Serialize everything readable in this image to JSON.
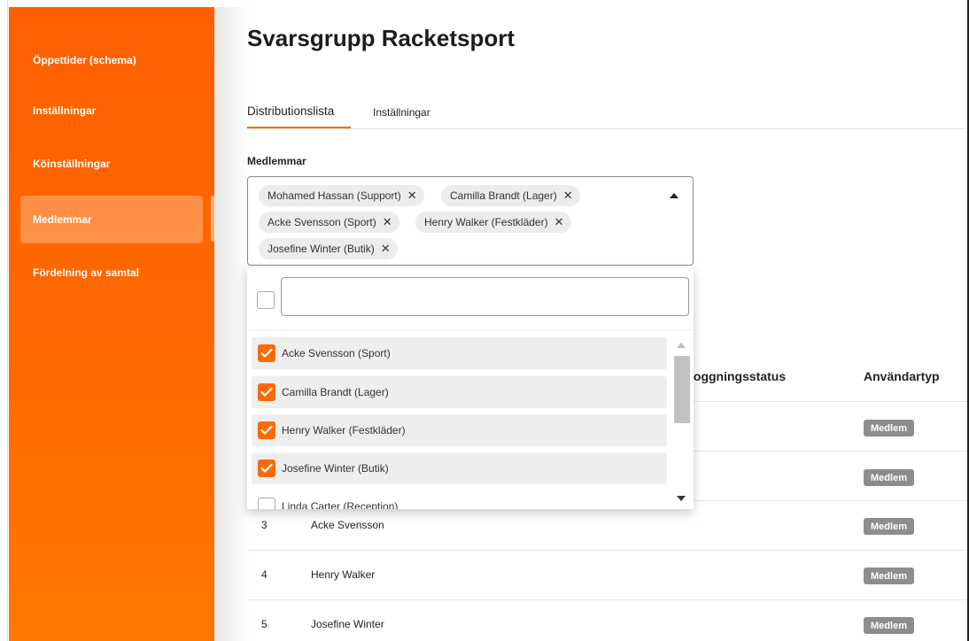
{
  "colors": {
    "accent": "#ff6a00",
    "sidebar": "#ff6200",
    "badge": "#8d8d8d"
  },
  "sidebar": {
    "items": [
      {
        "label": "Öppettider (schema)",
        "active": false
      },
      {
        "label": "Inställningar",
        "active": false
      },
      {
        "label": "Köinställningar",
        "active": false
      },
      {
        "label": "Medlemmar",
        "active": true
      },
      {
        "label": "Fördelning av samtal",
        "active": false
      }
    ]
  },
  "page": {
    "title": "Svarsgrupp Racketsport"
  },
  "tabs": [
    {
      "label": "Distributionslista",
      "active": true
    },
    {
      "label": "Inställningar",
      "active": false
    }
  ],
  "members_field": {
    "label": "Medlemmar",
    "chips": [
      "Mohamed Hassan (Support)",
      "Camilla Brandt (Lager)",
      "Acke Svensson (Sport)",
      "Henry Walker (Festkläder)",
      "Josefine Winter (Butik)"
    ],
    "chip_remove_glyph": "✕",
    "search_value": "",
    "options": [
      {
        "label": "Acke Svensson (Sport)",
        "checked": true
      },
      {
        "label": "Camilla Brandt (Lager)",
        "checked": true
      },
      {
        "label": "Henry Walker (Festkläder)",
        "checked": true
      },
      {
        "label": "Josefine Winter (Butik)",
        "checked": true
      },
      {
        "label": "Linda Carter (Reception)",
        "checked": false
      }
    ]
  },
  "table": {
    "headers": {
      "login_status": "loggningsstatus",
      "user_type": "Användartyp"
    },
    "rows": [
      {
        "num": "",
        "name": "",
        "type": "Medlem"
      },
      {
        "num": "",
        "name": "",
        "type": "Medlem"
      },
      {
        "num": "3",
        "name": "Acke Svensson",
        "type": "Medlem"
      },
      {
        "num": "4",
        "name": "Henry Walker",
        "type": "Medlem"
      },
      {
        "num": "5",
        "name": "Josefine Winter",
        "type": "Medlem"
      }
    ]
  }
}
